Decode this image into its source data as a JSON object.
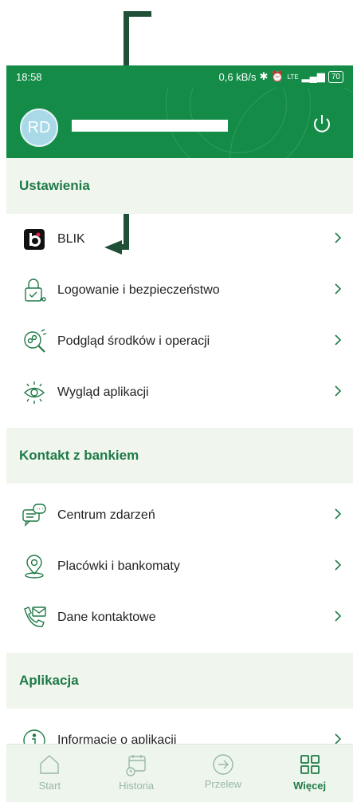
{
  "status_bar": {
    "time": "18:58",
    "speed": "0,6 kB/s",
    "network": "LTE",
    "battery": "70"
  },
  "header": {
    "avatar_initials": "RD"
  },
  "sections": [
    {
      "title": "Ustawienia",
      "items": [
        {
          "label": "BLIK",
          "icon": "blik-icon"
        },
        {
          "label": "Logowanie i bezpieczeństwo",
          "icon": "lock-key-icon"
        },
        {
          "label": "Podgląd środków i operacji",
          "icon": "search-coins-icon"
        },
        {
          "label": "Wygląd aplikacji",
          "icon": "eye-icon"
        }
      ]
    },
    {
      "title": "Kontakt z bankiem",
      "items": [
        {
          "label": "Centrum zdarzeń",
          "icon": "chat-bubbles-icon"
        },
        {
          "label": "Placówki i bankomaty",
          "icon": "map-pin-icon"
        },
        {
          "label": "Dane kontaktowe",
          "icon": "phone-envelope-icon"
        }
      ]
    },
    {
      "title": "Aplikacja",
      "items": [
        {
          "label": "Informacje o aplikacji",
          "icon": "info-icon"
        }
      ]
    }
  ],
  "bottom_nav": [
    {
      "label": "Start",
      "icon": "home-icon"
    },
    {
      "label": "Historia",
      "icon": "calendar-clock-icon"
    },
    {
      "label": "Przelew",
      "icon": "arrow-circle-icon"
    },
    {
      "label": "Więcej",
      "icon": "grid-icon",
      "active": true
    }
  ],
  "colors": {
    "brand_green": "#148c48",
    "section_bg": "#f0f6ee",
    "section_text": "#1f7a47",
    "arrow": "#1f4f37"
  }
}
